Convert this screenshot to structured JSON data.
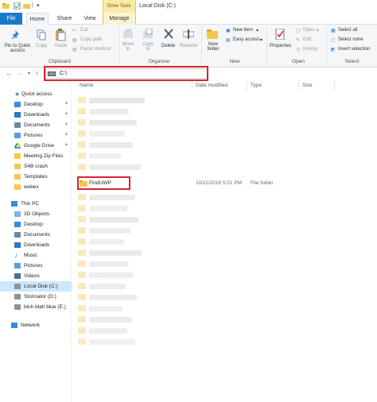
{
  "window": {
    "title": "Local Disk (C:)",
    "contextual_group": "Drive Tools"
  },
  "tabs": [
    "File",
    "Home",
    "Share",
    "View",
    "Manage"
  ],
  "ribbon": {
    "clipboard": {
      "pin": "Pin to Quick",
      "pin2": "access",
      "copy": "Copy",
      "paste": "Paste",
      "cut": "Cut",
      "copy_path": "Copy path",
      "paste_shortcut": "Paste shortcut",
      "label": "Clipboard"
    },
    "organise": {
      "move_to": "Move",
      "move_to2": "to",
      "copy_to": "Copy",
      "copy_to2": "to",
      "delete": "Delete",
      "rename": "Rename",
      "label": "Organise"
    },
    "new": {
      "new_folder": "New",
      "new_folder2": "folder",
      "new_item": "New item",
      "easy_access": "Easy access",
      "label": "New"
    },
    "open": {
      "properties": "Properties",
      "open": "Open",
      "edit": "Edit",
      "history": "History",
      "label": "Open"
    },
    "select": {
      "select_all": "Select all",
      "select_none": "Select none",
      "invert_selection": "Invert selection",
      "label": "Select"
    }
  },
  "address": {
    "path": "C:\\"
  },
  "columns": [
    "Name",
    "Date modified",
    "Type",
    "Size"
  ],
  "nav": {
    "quick_access": "Quick access",
    "quick_items": [
      "Desktop",
      "Downloads",
      "Documents",
      "Pictures",
      "Google Drive",
      "Meeting Zip Files",
      "S4B crash",
      "Templates",
      "webex"
    ],
    "this_pc": "This PC",
    "pc_items": [
      "3D Objects",
      "Desktop",
      "Documents",
      "Downloads",
      "Music",
      "Pictures",
      "Videos",
      "Local Disk (C:)",
      "Storinator (D:)",
      "bluh blah blue (E:)"
    ],
    "network": "Network"
  },
  "files": {
    "highlighted": {
      "name": "FindUWP",
      "date": "10/11/2018 5:01 PM",
      "type": "File folder"
    }
  },
  "colors": {
    "accent": "#1979ca",
    "highlight": "#d9232f",
    "selected": "#cce8ff",
    "folder": "#f3d37a"
  }
}
